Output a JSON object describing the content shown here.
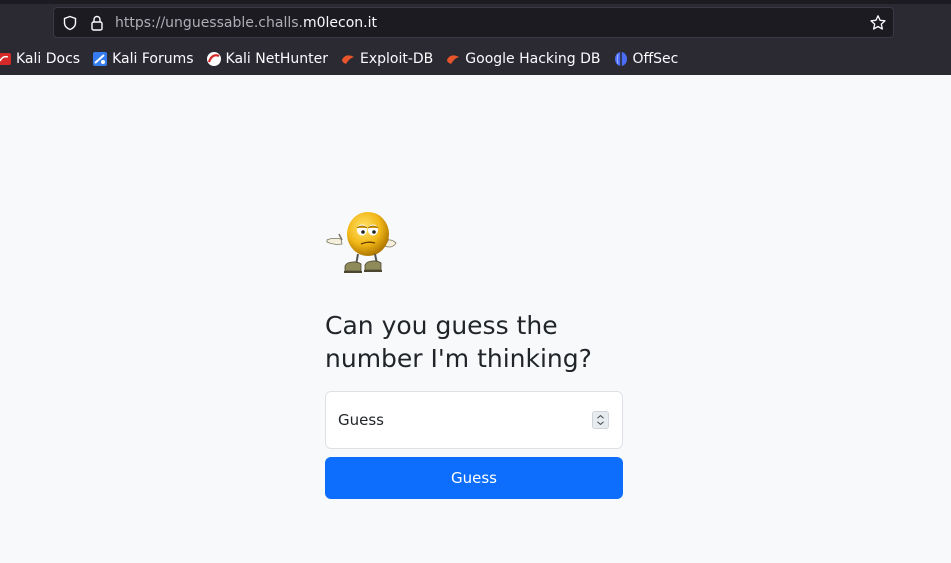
{
  "browser": {
    "url_prefix": "https://unguessable.challs.",
    "url_host": "m0lecon.it",
    "bookmarks": [
      {
        "label": "Kali Docs",
        "icon": "kali-docs-icon"
      },
      {
        "label": "Kali Forums",
        "icon": "kali-forums-icon"
      },
      {
        "label": "Kali NetHunter",
        "icon": "kali-nethunter-icon"
      },
      {
        "label": "Exploit-DB",
        "icon": "exploit-db-icon"
      },
      {
        "label": "Google Hacking DB",
        "icon": "ghdb-icon"
      },
      {
        "label": "OffSec",
        "icon": "offsec-icon"
      }
    ]
  },
  "page": {
    "heading": "Can you guess the number I'm thinking?",
    "input_placeholder": "Guess",
    "button_label": "Guess",
    "image": "thinking-smiley-emoji"
  },
  "colors": {
    "primary": "#0d6efd",
    "page_bg": "#f8f9fa",
    "chrome_bg": "#2b2a33"
  }
}
